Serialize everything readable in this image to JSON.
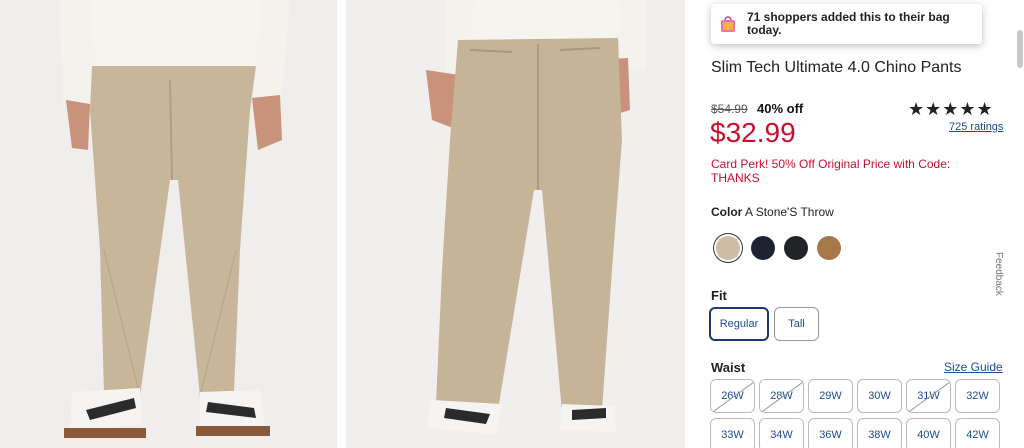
{
  "toast": {
    "message": "71 shoppers added this to their bag today.",
    "icon": "shopping-bag-icon"
  },
  "product": {
    "title": "Slim Tech Ultimate 4.0 Chino Pants",
    "original_price": "$54.99",
    "discount": "40% off",
    "price": "$32.99",
    "perk": "Card Perk! 50% Off Original Price with Code: THANKS",
    "stars": "★★★★★",
    "rating_value": 4.5,
    "ratings_link": "725 ratings"
  },
  "color": {
    "label": "Color",
    "selected": "A Stone'S Throw",
    "swatches": [
      {
        "name": "A Stone'S Throw",
        "hex": "#cdbca6"
      },
      {
        "name": "navy",
        "hex": "#1e2333"
      },
      {
        "name": "black",
        "hex": "#232427"
      },
      {
        "name": "brown",
        "hex": "#a5794a"
      }
    ]
  },
  "fit": {
    "label": "Fit",
    "options": [
      "Regular",
      "Tall"
    ],
    "selected": "Regular"
  },
  "waist": {
    "label": "Waist",
    "size_guide": "Size Guide",
    "sizes": [
      {
        "label": "26W",
        "available": false
      },
      {
        "label": "28W",
        "available": false
      },
      {
        "label": "29W",
        "available": true
      },
      {
        "label": "30W",
        "available": true
      },
      {
        "label": "31W",
        "available": false
      },
      {
        "label": "32W",
        "available": true
      },
      {
        "label": "33W",
        "available": true
      },
      {
        "label": "34W",
        "available": true
      },
      {
        "label": "36W",
        "available": true
      },
      {
        "label": "38W",
        "available": true
      },
      {
        "label": "40W",
        "available": true
      },
      {
        "label": "42W",
        "available": true
      }
    ]
  },
  "feedback_tab": "Feedback",
  "colors": {
    "sale_red": "#c8102e",
    "link_blue": "#1d4d8f",
    "khaki": "#c9b79c"
  }
}
